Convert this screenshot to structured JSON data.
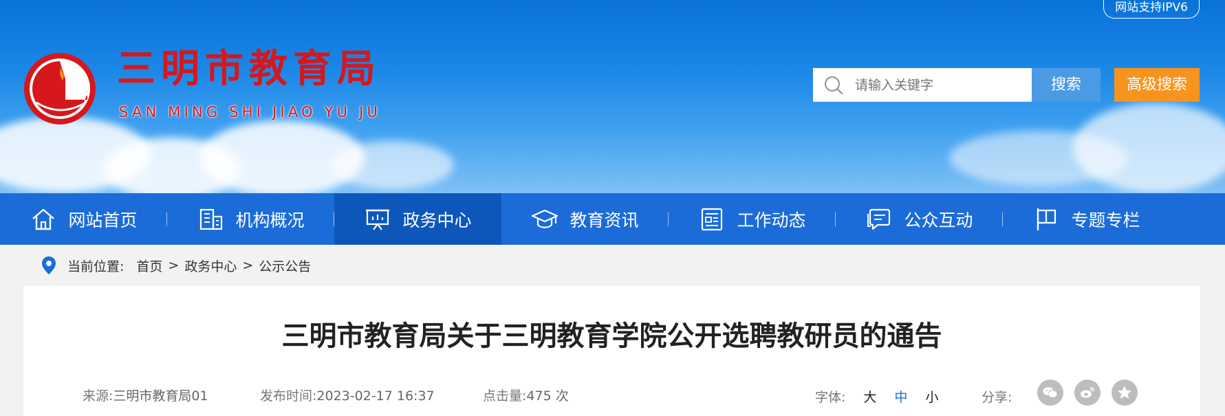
{
  "header": {
    "ipv6_badge": "网站支持IPV6",
    "site_title": "三明市教育局",
    "site_pinyin": "SAN MING SHI JIAO YU JU",
    "search_placeholder": "请输入关键字",
    "search_button": "搜索",
    "advanced_search_button": "高级搜索",
    "colors": {
      "brand_red": "#d6171b",
      "nav_blue": "#1b6cd8",
      "search_blue": "#4a9ae4",
      "orange": "#f7941d"
    }
  },
  "nav": {
    "items": [
      {
        "label": "网站首页",
        "icon": "home-icon"
      },
      {
        "label": "机构概况",
        "icon": "building-icon"
      },
      {
        "label": "政务中心",
        "icon": "presentation-icon",
        "active": true
      },
      {
        "label": "教育资讯",
        "icon": "graduation-cap-icon"
      },
      {
        "label": "工作动态",
        "icon": "newspaper-icon"
      },
      {
        "label": "公众互动",
        "icon": "chat-icon"
      },
      {
        "label": "专题专栏",
        "icon": "flag-icon"
      }
    ]
  },
  "breadcrumb": {
    "prefix": "当前位置:",
    "items": [
      "首页",
      "政务中心",
      "公示公告"
    ],
    "separator": ">"
  },
  "article": {
    "title": "三明市教育局关于三明教育学院公开选聘教研员的通告",
    "source_label": "来源:",
    "source_value": "三明市教育局01",
    "time_label": "发布时间:",
    "time_value": "2023-02-17 16:37",
    "hits_label": "点击量:",
    "hits_value": "475 次",
    "font_label": "字体:",
    "font_large": "大",
    "font_medium": "中",
    "font_small": "小",
    "share_label": "分享:",
    "share_icons": [
      "wechat-icon",
      "weibo-icon",
      "favorite-icon"
    ]
  }
}
